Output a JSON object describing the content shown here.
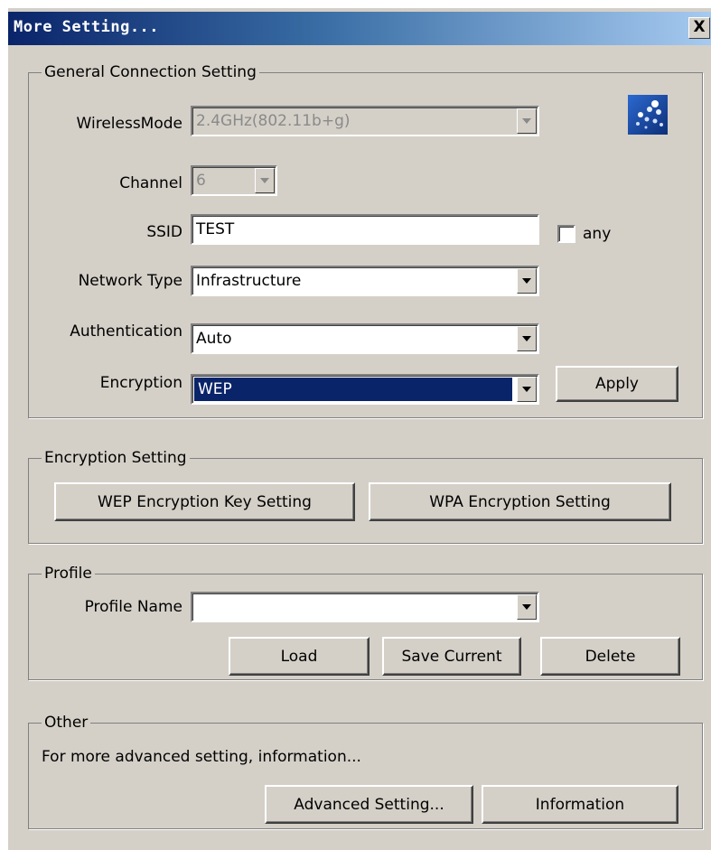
{
  "window": {
    "title": "More Setting...",
    "close_label": "X"
  },
  "general": {
    "group_title": "General Connection Setting",
    "wireless_mode_label": "WirelessMode",
    "wireless_mode_value": "2.4GHz(802.11b+g)",
    "channel_label": "Channel",
    "channel_value": "6",
    "ssid_label": "SSID",
    "ssid_value": "TEST",
    "any_label": "any",
    "any_checked": false,
    "network_type_label": "Network Type",
    "network_type_value": "Infrastructure",
    "authentication_label": "Authentication",
    "authentication_value": "Auto",
    "encryption_label": "Encryption",
    "encryption_value": "WEP",
    "apply_label": "Apply",
    "icon": "wireless-network-icon"
  },
  "encryption_setting": {
    "group_title": "Encryption Setting",
    "wep_button": "WEP Encryption Key Setting",
    "wpa_button": "WPA Encryption Setting"
  },
  "profile": {
    "group_title": "Profile",
    "name_label": "Profile Name",
    "name_value": "",
    "load_button": "Load",
    "save_button": "Save Current",
    "delete_button": "Delete"
  },
  "other": {
    "group_title": "Other",
    "description": "For more advanced setting, information...",
    "advanced_button": "Advanced Setting...",
    "information_button": "Information"
  },
  "colors": {
    "face": "#d4d0c8",
    "titlebar_start": "#0a246a",
    "titlebar_end": "#a6caf0",
    "selection": "#0a246a"
  }
}
